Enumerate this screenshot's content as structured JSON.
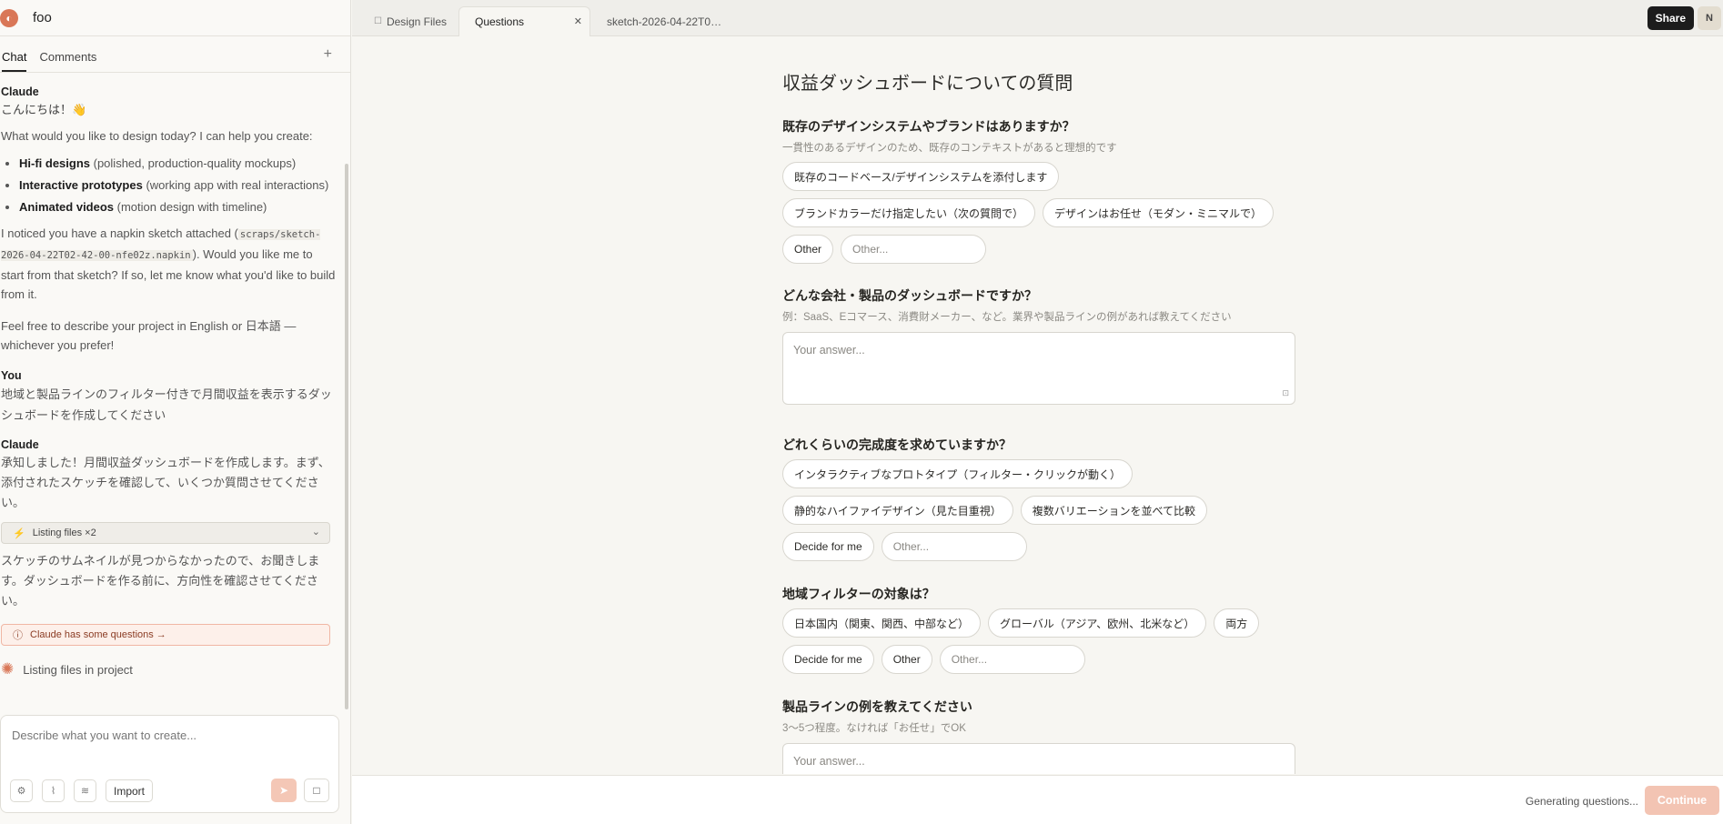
{
  "project": {
    "name": "foo"
  },
  "left_tabs": {
    "chat": "Chat",
    "comments": "Comments",
    "plus": "+"
  },
  "chat": {
    "m1_author": "Claude",
    "m1_greeting": "こんにちは！👋",
    "m1_question": "What would you like to design today? I can help you create:",
    "m1_items": [
      {
        "bold": "Hi-fi designs",
        "rest": " (polished, production-quality mockups)"
      },
      {
        "bold": "Interactive prototypes",
        "rest": " (working app with real interactions)"
      },
      {
        "bold": "Animated videos",
        "rest": " (motion design with timeline)"
      }
    ],
    "m1_sketch_pre": "I noticed you have a napkin sketch attached (",
    "m1_sketch_code": "scraps/sketch-2026-04-22T02-42-00-nfe02z.napkin",
    "m1_sketch_post": "). Would you like me to start from that sketch? If so, let me know what you'd like to build from it.",
    "m1_lang": "Feel free to describe your project in English or 日本語 — whichever you prefer!",
    "m2_author": "You",
    "m2_text": "地域と製品ラインのフィルター付きで月間収益を表示するダッシュボードを作成してください",
    "m3_author": "Claude",
    "m3_text": "承知しました！月間収益ダッシュボードを作成します。まず、添付されたスケッチを確認して、いくつか質問させてください。",
    "tool_chip": "Listing files ×2",
    "m3_text2": "スケッチのサムネイルが見つからなかったので、お聞きします。ダッシュボードを作る前に、方向性を確認させてください。",
    "questions_chip": "Claude has some questions →",
    "status": "Listing files in project"
  },
  "composer": {
    "placeholder": "Describe what you want to create...",
    "import": "Import"
  },
  "tabs": [
    {
      "label": "Design Files"
    },
    {
      "label": "Questions"
    },
    {
      "label": "sketch-2026-04-22T0…"
    }
  ],
  "topbar": {
    "share": "Share",
    "avatar": "N"
  },
  "form": {
    "title": "収益ダッシュボードについての質問",
    "q1": {
      "title": "既存のデザインシステムやブランドはありますか？",
      "sub": "一貫性のあるデザインのため、既存のコンテキストがあると理想的です",
      "options": [
        "既存のコードベース/デザインシステムを添付します",
        "ブランドカラーだけ指定したい（次の質問で）",
        "デザインはお任せ（モダン・ミニマルで）",
        "Other"
      ],
      "other_placeholder": "Other..."
    },
    "q2": {
      "title": "どんな会社・製品のダッシュボードですか？",
      "sub": "例：SaaS、Eコマース、消費財メーカー、など。業界や製品ラインの例があれば教えてください",
      "placeholder": "Your answer..."
    },
    "q3": {
      "title": "どれくらいの完成度を求めていますか？",
      "options": [
        "インタラクティブなプロトタイプ（フィルター・クリックが動く）",
        "静的なハイファイデザイン（見た目重視）",
        "複数バリエーションを並べて比較",
        "Decide for me"
      ],
      "other_placeholder": "Other..."
    },
    "q4": {
      "title": "地域フィルターの対象は？",
      "options": [
        "日本国内（関東、関西、中部など）",
        "グローバル（アジア、欧州、北米など）",
        "両方",
        "Decide for me",
        "Other"
      ],
      "other_placeholder": "Other..."
    },
    "q5": {
      "title": "製品ラインの例を教えてください",
      "sub": "3〜5つ程度。なければ「お任せ」でOK",
      "placeholder": "Your answer..."
    }
  },
  "bottom": {
    "status": "Generating questions...",
    "continue": "Continue"
  },
  "colors": {
    "accent": "#d97757",
    "dark_button": "#1c1c1c",
    "continue_disabled": "#f3c4b3"
  }
}
